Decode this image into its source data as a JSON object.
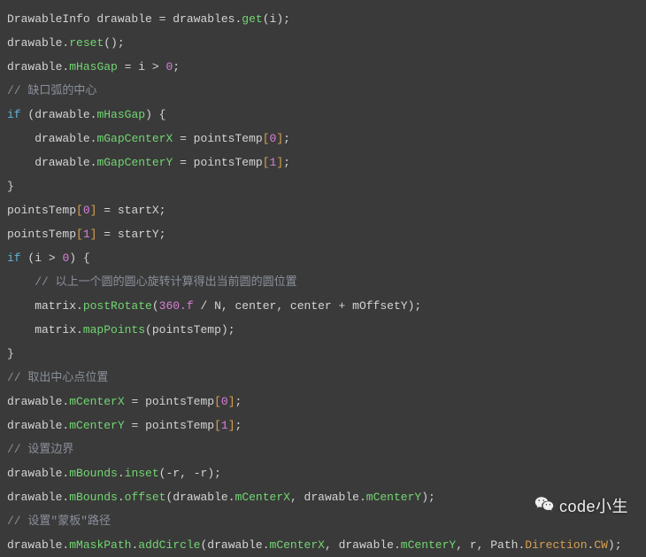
{
  "lines": [
    [
      {
        "c": "t-type",
        "t": "DrawableInfo "
      },
      {
        "c": "t-ident",
        "t": "drawable "
      },
      {
        "c": "t-op",
        "t": "= "
      },
      {
        "c": "t-ident",
        "t": "drawables"
      },
      {
        "c": "t-dot",
        "t": "."
      },
      {
        "c": "t-method",
        "t": "get"
      },
      {
        "c": "t-paren",
        "t": "("
      },
      {
        "c": "t-ident",
        "t": "i"
      },
      {
        "c": "t-paren",
        "t": ")"
      },
      {
        "c": "t-punc",
        "t": ";"
      }
    ],
    [
      {
        "c": "t-ident",
        "t": "drawable"
      },
      {
        "c": "t-dot",
        "t": "."
      },
      {
        "c": "t-method",
        "t": "reset"
      },
      {
        "c": "t-paren",
        "t": "()"
      },
      {
        "c": "t-punc",
        "t": ";"
      }
    ],
    [
      {
        "c": "t-ident",
        "t": "drawable"
      },
      {
        "c": "t-dot",
        "t": "."
      },
      {
        "c": "t-method",
        "t": "mHasGap"
      },
      {
        "c": "t-op",
        "t": " = "
      },
      {
        "c": "t-ident",
        "t": "i "
      },
      {
        "c": "t-op",
        "t": "> "
      },
      {
        "c": "t-num",
        "t": "0"
      },
      {
        "c": "t-punc",
        "t": ";"
      }
    ],
    [
      {
        "c": "t-comment",
        "t": "// 缺口弧的中心"
      }
    ],
    [
      {
        "c": "t-keyword",
        "t": "if"
      },
      {
        "c": "t-paren",
        "t": " ("
      },
      {
        "c": "t-ident",
        "t": "drawable"
      },
      {
        "c": "t-dot",
        "t": "."
      },
      {
        "c": "t-method",
        "t": "mHasGap"
      },
      {
        "c": "t-paren",
        "t": ")"
      },
      {
        "c": "t-brace",
        "t": " {"
      }
    ],
    [
      {
        "c": "t-ident",
        "t": "    drawable"
      },
      {
        "c": "t-dot",
        "t": "."
      },
      {
        "c": "t-method",
        "t": "mGapCenterX"
      },
      {
        "c": "t-op",
        "t": " = "
      },
      {
        "c": "t-ident",
        "t": "pointsTemp"
      },
      {
        "c": "t-bracket",
        "t": "["
      },
      {
        "c": "t-num",
        "t": "0"
      },
      {
        "c": "t-bracket",
        "t": "]"
      },
      {
        "c": "t-punc",
        "t": ";"
      }
    ],
    [
      {
        "c": "t-ident",
        "t": "    drawable"
      },
      {
        "c": "t-dot",
        "t": "."
      },
      {
        "c": "t-method",
        "t": "mGapCenterY"
      },
      {
        "c": "t-op",
        "t": " = "
      },
      {
        "c": "t-ident",
        "t": "pointsTemp"
      },
      {
        "c": "t-bracket",
        "t": "["
      },
      {
        "c": "t-num",
        "t": "1"
      },
      {
        "c": "t-bracket",
        "t": "]"
      },
      {
        "c": "t-punc",
        "t": ";"
      }
    ],
    [
      {
        "c": "t-brace",
        "t": "}"
      }
    ],
    [
      {
        "c": "t-ident",
        "t": "pointsTemp"
      },
      {
        "c": "t-bracket",
        "t": "["
      },
      {
        "c": "t-num",
        "t": "0"
      },
      {
        "c": "t-bracket",
        "t": "]"
      },
      {
        "c": "t-op",
        "t": " = "
      },
      {
        "c": "t-ident",
        "t": "startX"
      },
      {
        "c": "t-punc",
        "t": ";"
      }
    ],
    [
      {
        "c": "t-ident",
        "t": "pointsTemp"
      },
      {
        "c": "t-bracket",
        "t": "["
      },
      {
        "c": "t-num",
        "t": "1"
      },
      {
        "c": "t-bracket",
        "t": "]"
      },
      {
        "c": "t-op",
        "t": " = "
      },
      {
        "c": "t-ident",
        "t": "startY"
      },
      {
        "c": "t-punc",
        "t": ";"
      }
    ],
    [
      {
        "c": "t-keyword",
        "t": "if"
      },
      {
        "c": "t-paren",
        "t": " ("
      },
      {
        "c": "t-ident",
        "t": "i "
      },
      {
        "c": "t-op",
        "t": "> "
      },
      {
        "c": "t-num",
        "t": "0"
      },
      {
        "c": "t-paren",
        "t": ")"
      },
      {
        "c": "t-brace",
        "t": " {"
      }
    ],
    [
      {
        "c": "t-comment",
        "t": "    // 以上一个圆的圆心旋转计算得出当前圆的圆位置"
      }
    ],
    [
      {
        "c": "t-ident",
        "t": "    matrix"
      },
      {
        "c": "t-dot",
        "t": "."
      },
      {
        "c": "t-method",
        "t": "postRotate"
      },
      {
        "c": "t-paren",
        "t": "("
      },
      {
        "c": "t-num",
        "t": "360.f"
      },
      {
        "c": "t-op",
        "t": " / "
      },
      {
        "c": "t-ident",
        "t": "N"
      },
      {
        "c": "t-punc",
        "t": ", "
      },
      {
        "c": "t-ident",
        "t": "center"
      },
      {
        "c": "t-punc",
        "t": ", "
      },
      {
        "c": "t-ident",
        "t": "center "
      },
      {
        "c": "t-op",
        "t": "+ "
      },
      {
        "c": "t-ident",
        "t": "mOffsetY"
      },
      {
        "c": "t-paren",
        "t": ")"
      },
      {
        "c": "t-punc",
        "t": ";"
      }
    ],
    [
      {
        "c": "t-ident",
        "t": "    matrix"
      },
      {
        "c": "t-dot",
        "t": "."
      },
      {
        "c": "t-method",
        "t": "mapPoints"
      },
      {
        "c": "t-paren",
        "t": "("
      },
      {
        "c": "t-ident",
        "t": "pointsTemp"
      },
      {
        "c": "t-paren",
        "t": ")"
      },
      {
        "c": "t-punc",
        "t": ";"
      }
    ],
    [
      {
        "c": "t-brace",
        "t": "}"
      }
    ],
    [
      {
        "c": "t-comment",
        "t": "// 取出中心点位置"
      }
    ],
    [
      {
        "c": "t-ident",
        "t": "drawable"
      },
      {
        "c": "t-dot",
        "t": "."
      },
      {
        "c": "t-method",
        "t": "mCenterX"
      },
      {
        "c": "t-op",
        "t": " = "
      },
      {
        "c": "t-ident",
        "t": "pointsTemp"
      },
      {
        "c": "t-bracket",
        "t": "["
      },
      {
        "c": "t-num",
        "t": "0"
      },
      {
        "c": "t-bracket",
        "t": "]"
      },
      {
        "c": "t-punc",
        "t": ";"
      }
    ],
    [
      {
        "c": "t-ident",
        "t": "drawable"
      },
      {
        "c": "t-dot",
        "t": "."
      },
      {
        "c": "t-method",
        "t": "mCenterY"
      },
      {
        "c": "t-op",
        "t": " = "
      },
      {
        "c": "t-ident",
        "t": "pointsTemp"
      },
      {
        "c": "t-bracket",
        "t": "["
      },
      {
        "c": "t-num",
        "t": "1"
      },
      {
        "c": "t-bracket",
        "t": "]"
      },
      {
        "c": "t-punc",
        "t": ";"
      }
    ],
    [
      {
        "c": "t-comment",
        "t": "// 设置边界"
      }
    ],
    [
      {
        "c": "t-ident",
        "t": "drawable"
      },
      {
        "c": "t-dot",
        "t": "."
      },
      {
        "c": "t-method",
        "t": "mBounds"
      },
      {
        "c": "t-dot",
        "t": "."
      },
      {
        "c": "t-method",
        "t": "inset"
      },
      {
        "c": "t-paren",
        "t": "("
      },
      {
        "c": "t-op",
        "t": "-"
      },
      {
        "c": "t-ident",
        "t": "r"
      },
      {
        "c": "t-punc",
        "t": ", "
      },
      {
        "c": "t-op",
        "t": "-"
      },
      {
        "c": "t-ident",
        "t": "r"
      },
      {
        "c": "t-paren",
        "t": ")"
      },
      {
        "c": "t-punc",
        "t": ";"
      }
    ],
    [
      {
        "c": "t-ident",
        "t": "drawable"
      },
      {
        "c": "t-dot",
        "t": "."
      },
      {
        "c": "t-method",
        "t": "mBounds"
      },
      {
        "c": "t-dot",
        "t": "."
      },
      {
        "c": "t-method",
        "t": "offset"
      },
      {
        "c": "t-paren",
        "t": "("
      },
      {
        "c": "t-ident",
        "t": "drawable"
      },
      {
        "c": "t-dot",
        "t": "."
      },
      {
        "c": "t-method",
        "t": "mCenterX"
      },
      {
        "c": "t-punc",
        "t": ", "
      },
      {
        "c": "t-ident",
        "t": "drawable"
      },
      {
        "c": "t-dot",
        "t": "."
      },
      {
        "c": "t-method",
        "t": "mCenterY"
      },
      {
        "c": "t-paren",
        "t": ")"
      },
      {
        "c": "t-punc",
        "t": ";"
      }
    ],
    [
      {
        "c": "t-comment",
        "t": "// 设置\"蒙板\"路径"
      }
    ],
    [
      {
        "c": "t-ident",
        "t": "drawable"
      },
      {
        "c": "t-dot",
        "t": "."
      },
      {
        "c": "t-method",
        "t": "mMaskPath"
      },
      {
        "c": "t-dot",
        "t": "."
      },
      {
        "c": "t-method",
        "t": "addCircle"
      },
      {
        "c": "t-paren",
        "t": "("
      },
      {
        "c": "t-ident",
        "t": "drawable"
      },
      {
        "c": "t-dot",
        "t": "."
      },
      {
        "c": "t-method",
        "t": "mCenterX"
      },
      {
        "c": "t-punc",
        "t": ", "
      },
      {
        "c": "t-ident",
        "t": "drawable"
      },
      {
        "c": "t-dot",
        "t": "."
      },
      {
        "c": "t-method",
        "t": "mCenterY"
      },
      {
        "c": "t-punc",
        "t": ", "
      },
      {
        "c": "t-ident",
        "t": "r"
      },
      {
        "c": "t-punc",
        "t": ", "
      },
      {
        "c": "t-ident",
        "t": "Path"
      },
      {
        "c": "t-dot",
        "t": "."
      },
      {
        "c": "t-attr",
        "t": "Direction"
      },
      {
        "c": "t-dot",
        "t": "."
      },
      {
        "c": "t-attr",
        "t": "CW"
      },
      {
        "c": "t-paren",
        "t": ")"
      },
      {
        "c": "t-punc",
        "t": ";"
      }
    ]
  ],
  "watermark": "code小生"
}
